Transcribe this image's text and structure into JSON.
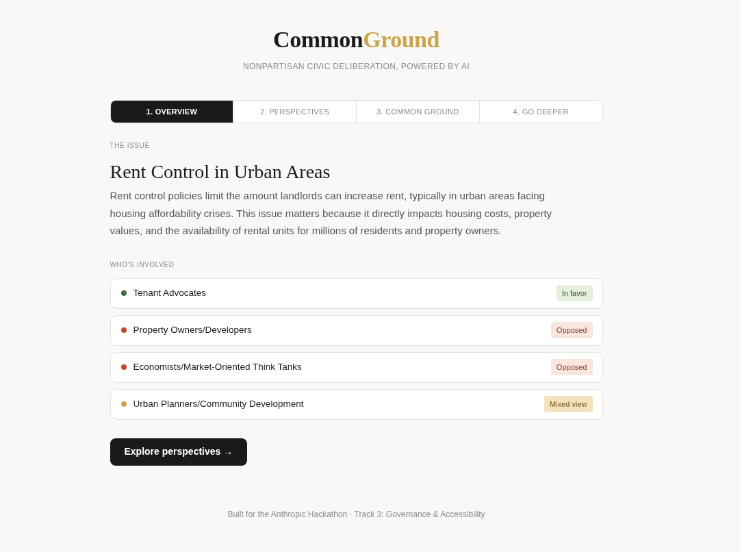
{
  "header": {
    "logo": {
      "primary": "Common",
      "accent": "Ground"
    },
    "tagline": "NONPARTISAN CIVIC DELIBERATION, POWERED BY AI"
  },
  "tabs": [
    {
      "label": "1. OVERVIEW",
      "selected": true
    },
    {
      "label": "2. PERSPECTIVES",
      "selected": false
    },
    {
      "label": "3. COMMON GROUND",
      "selected": false
    },
    {
      "label": "4. GO DEEPER",
      "selected": false
    }
  ],
  "issue": {
    "section_label": "THE ISSUE",
    "title": "Rent Control in Urban Areas",
    "description": "Rent control policies limit the amount landlords can increase rent, typically in urban areas facing housing affordability crises. This issue matters because it directly impacts housing costs, property values, and the availability of rental units for millions of residents and property owners."
  },
  "involved": {
    "section_label": "WHO'S INVOLVED",
    "stakeholders": [
      {
        "name": "Tenant Advocates",
        "color": "#3d6b4a",
        "stance": {
          "kind": "favor",
          "label": "In favor"
        }
      },
      {
        "name": "Property Owners/Developers",
        "color": "#c0492b",
        "stance": {
          "kind": "opposed",
          "label": "Opposed"
        }
      },
      {
        "name": "Economists/Market-Oriented Think Tanks",
        "color": "#c0492b",
        "stance": {
          "kind": "opposed",
          "label": "Opposed"
        }
      },
      {
        "name": "Urban Planners/Community Development",
        "color": "#c9a54c",
        "stance": {
          "kind": "mixed",
          "label": "Mixed view"
        }
      }
    ]
  },
  "primary_action": {
    "label": "Explore perspectives →"
  },
  "footer": "Built for the Anthropic Hackathon · Track 3: Governance & Accessibility"
}
